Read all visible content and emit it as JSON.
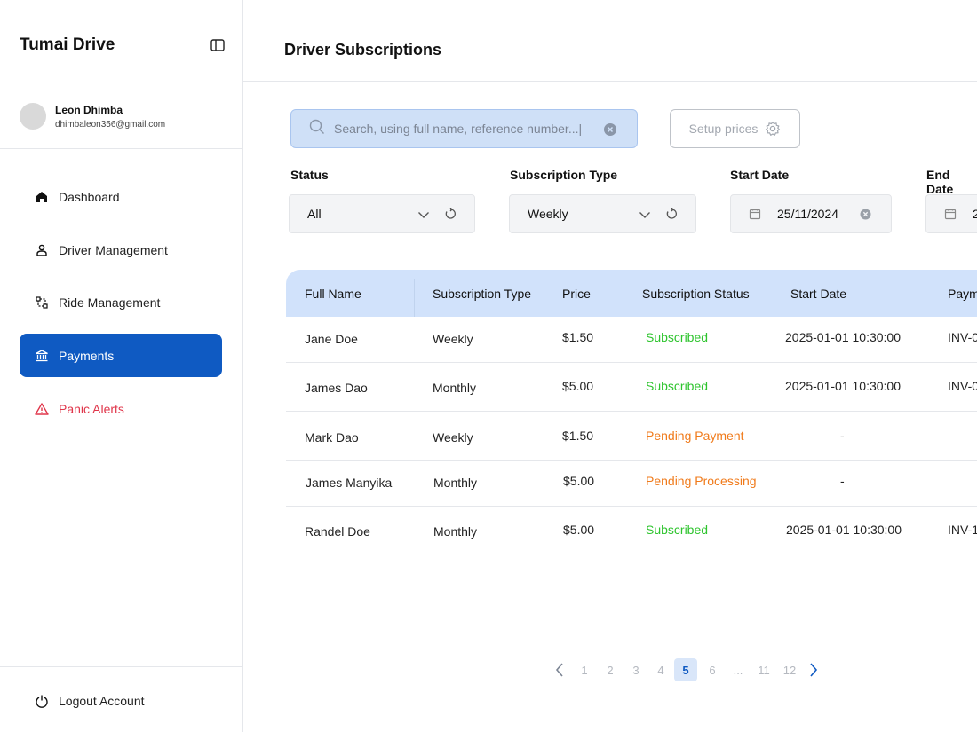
{
  "app": {
    "brand": "Tumai Drive",
    "user": {
      "name": "Leon Dhimba",
      "email": "dhimbaleon356@gmail.com"
    }
  },
  "sidebar": {
    "items": [
      {
        "label": "Dashboard",
        "icon": "home-icon"
      },
      {
        "label": "Driver Management",
        "icon": "user-icon"
      },
      {
        "label": "Ride Management",
        "icon": "route-icon"
      },
      {
        "label": "Payments",
        "icon": "bank-icon",
        "active": true
      },
      {
        "label": "Panic Alerts",
        "icon": "warning-icon",
        "color": "#e0364b"
      }
    ],
    "logout_label": "Logout Account"
  },
  "page": {
    "title": "Driver Subscriptions"
  },
  "search": {
    "placeholder": "Search, using full name, reference number...|"
  },
  "setup_button_label": "Setup prices",
  "filters": {
    "status": {
      "label": "Status",
      "value": "All"
    },
    "subscription_type": {
      "label": "Subscription Type",
      "value": "Weekly"
    },
    "start_date": {
      "label": "Start Date",
      "value": "25/11/2024"
    },
    "end_date": {
      "label": "End Date",
      "value": "2"
    }
  },
  "table": {
    "columns": [
      "Full Name",
      "Subscription Type",
      "Price",
      "Subscription Status",
      "Start Date",
      "Paym"
    ],
    "rows": [
      {
        "name": "Jane Doe",
        "type": "Weekly",
        "price": "$1.50",
        "status": "Subscribed",
        "start": "2025-01-01 10:30:00",
        "payment": "INV-0"
      },
      {
        "name": "James Dao",
        "type": "Monthly",
        "price": "$5.00",
        "status": "Subscribed",
        "start": "2025-01-01 10:30:00",
        "payment": "INV-0"
      },
      {
        "name": "Mark Dao",
        "type": "Weekly",
        "price": "$1.50",
        "status": "Pending Payment",
        "start": "-",
        "payment": ""
      },
      {
        "name": "James Manyika",
        "type": "Monthly",
        "price": "$5.00",
        "status": "Pending Processing",
        "start": "-",
        "payment": ""
      },
      {
        "name": "Randel Doe",
        "type": "Monthly",
        "price": "$5.00",
        "status": "Subscribed",
        "start": "2025-01-01 10:30:00",
        "payment": "INV-1"
      }
    ]
  },
  "pagination": {
    "pages": [
      "1",
      "2",
      "3",
      "4",
      "5",
      "6",
      "...",
      "11",
      "12"
    ],
    "current": "5"
  },
  "colors": {
    "accent": "#0f5ac2",
    "subscribed": "#2ec42e",
    "pending": "#f07a1a",
    "alert": "#e0364b",
    "table_header": "#d1e2fb"
  }
}
